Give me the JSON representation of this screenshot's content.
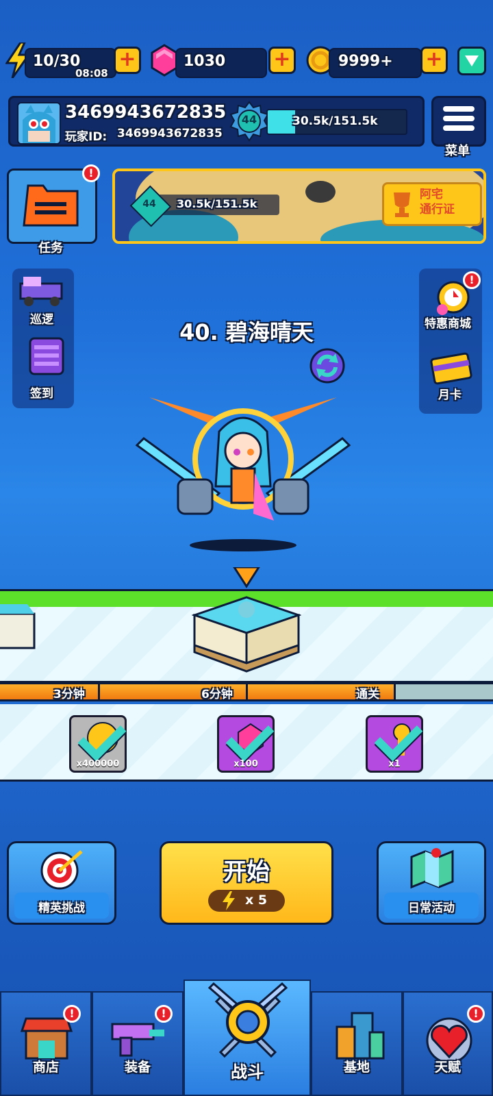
{
  "resources": {
    "energy": "10/30",
    "energy_timer": "08:08",
    "gems": "1030",
    "coins": "9999+"
  },
  "profile": {
    "name": "3469943672835",
    "player_id_label": "玩家ID:",
    "player_id": "3469943672835",
    "level": "44",
    "exp_text": "30.5k/151.5k",
    "exp_progress": 0.2,
    "menu_label": "菜单"
  },
  "tasks": {
    "label": "任务",
    "badge": "!"
  },
  "banner": {
    "level": "44",
    "exp_text": "30.5k/151.5k",
    "pass_label": "阿宅\n通行证"
  },
  "left_side": [
    {
      "label": "巡逻",
      "icon": "patrol-truck-icon"
    },
    {
      "label": "签到",
      "icon": "checkin-icon"
    }
  ],
  "right_side": [
    {
      "label": "特惠商城",
      "icon": "special-shop-icon",
      "badge": "!"
    },
    {
      "label": "月卡",
      "icon": "monthly-card-icon"
    }
  ],
  "stage": {
    "title": "40. 碧海晴天"
  },
  "milestones": [
    {
      "label": "3分钟",
      "qty": "x400000",
      "reward": "coin"
    },
    {
      "label": "6分钟",
      "qty": "x100",
      "reward": "gem"
    },
    {
      "label": "通关",
      "qty": "x1",
      "reward": "key"
    }
  ],
  "actions": {
    "elite": "精英挑战",
    "start": "开始",
    "start_cost": "x 5",
    "daily": "日常活动"
  },
  "nav": [
    {
      "label": "商店",
      "badge": "!"
    },
    {
      "label": "装备",
      "badge": "!"
    },
    {
      "label": "战斗",
      "badge": ""
    },
    {
      "label": "基地",
      "badge": ""
    },
    {
      "label": "天赋",
      "badge": "!"
    }
  ],
  "colors": {
    "accent_yellow": "#ffc61a",
    "badge_red": "#e8202a",
    "exp_cyan": "#3fe0e8"
  }
}
